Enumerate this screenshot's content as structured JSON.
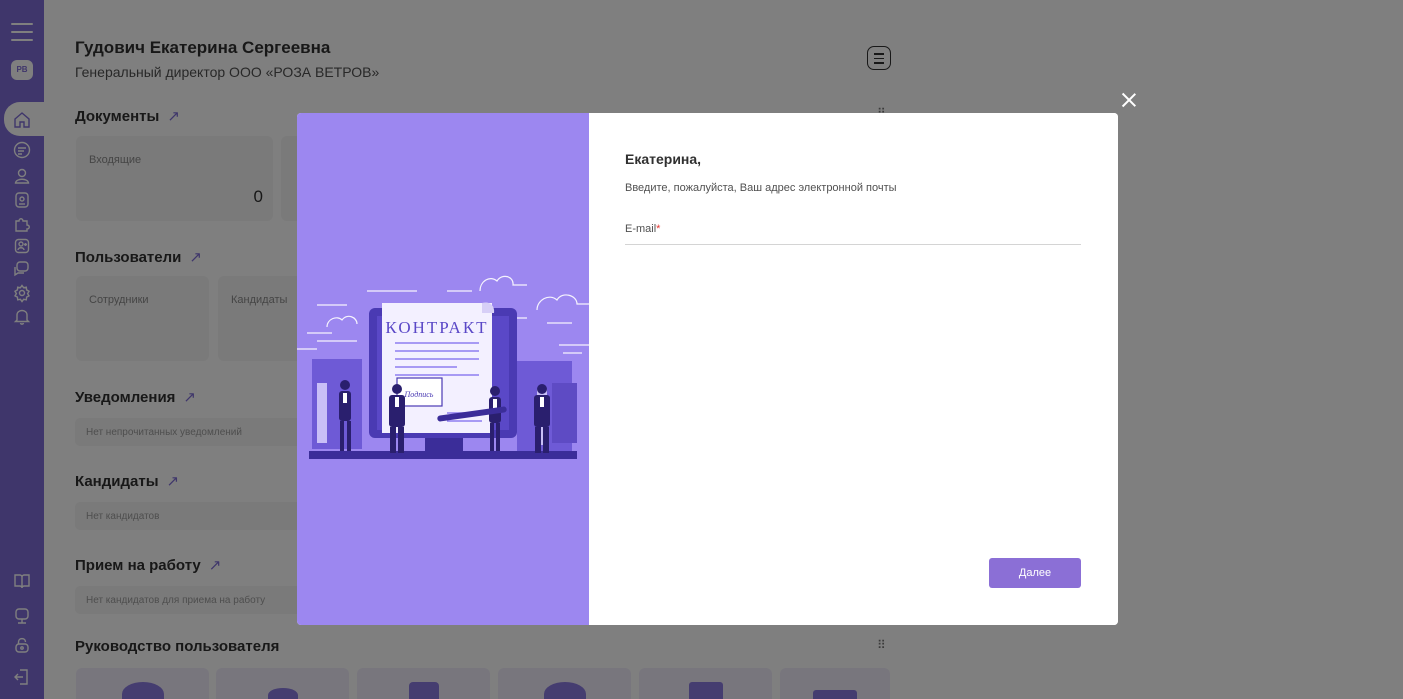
{
  "sidebar": {
    "logo_text": "PB",
    "accent_color": "#7e6cd7",
    "icons": [
      "menu-icon",
      "home-icon",
      "documents-icon",
      "user-icon",
      "badge-icon",
      "puzzle-icon",
      "add-user-icon",
      "chat-icon",
      "settings-icon",
      "bell-icon",
      "book-icon",
      "support-icon",
      "lock-icon",
      "logout-icon"
    ]
  },
  "header": {
    "user_name": "Гудович Екатерина Сергеевна",
    "user_role": "Генеральный директор ООО «РОЗА ВЕТРОВ»"
  },
  "sections": {
    "documents": {
      "title": "Документы",
      "arrow": "↗",
      "cards": [
        {
          "label": "Входящие",
          "value": "0"
        }
      ]
    },
    "users": {
      "title": "Пользователи",
      "arrow": "↗",
      "cards": [
        {
          "label": "Сотрудники"
        },
        {
          "label": "Кандидаты"
        }
      ]
    },
    "notifications": {
      "title": "Уведомления",
      "arrow": "↗",
      "empty": "Нет непрочитанных уведомлений"
    },
    "candidates": {
      "title": "Кандидаты",
      "arrow": "↗",
      "empty": "Нет кандидатов"
    },
    "hiring": {
      "title": "Прием на работу",
      "arrow": "↗",
      "empty": "Нет кандидатов для приема на работу"
    },
    "guide": {
      "title": "Руководство пользователя"
    }
  },
  "modal": {
    "illustration": {
      "contract_text": "КОНТРАКТ",
      "signature_text": "Подпись",
      "background_color": "#9c87f0"
    },
    "greeting": "Екатерина,",
    "prompt": "Введите, пожалуйста, Ваш адрес электронной почты",
    "email": {
      "label": "E-mail",
      "required_mark": "*",
      "value": ""
    },
    "next_button": "Далее",
    "button_color": "#8b6fd6"
  }
}
